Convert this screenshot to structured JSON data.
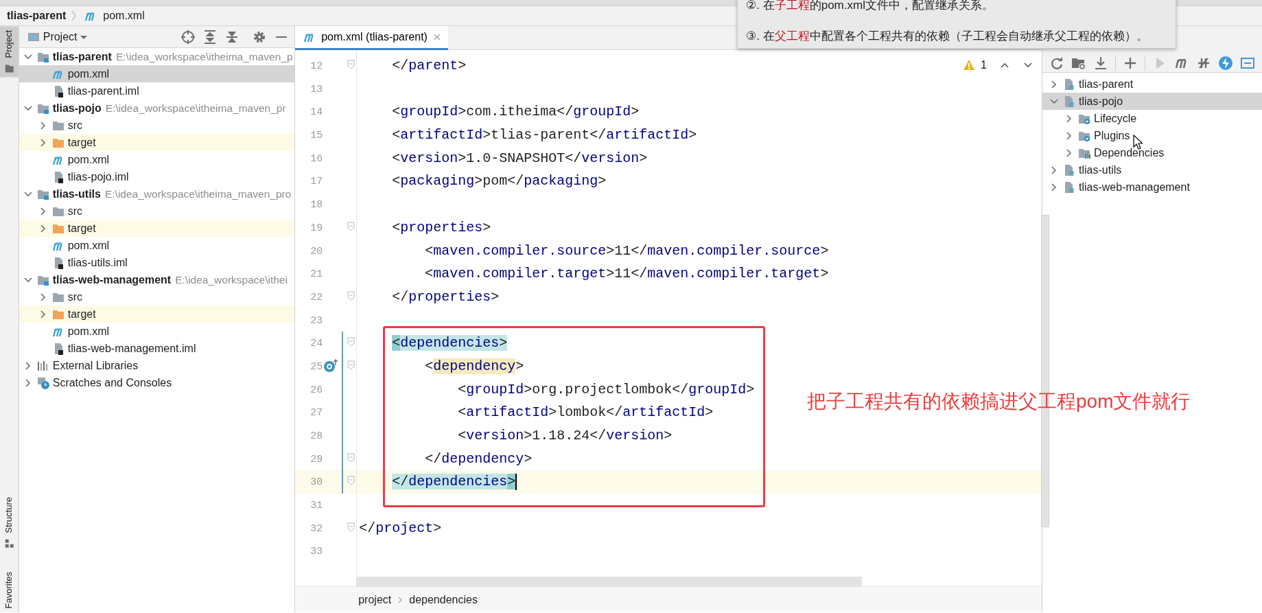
{
  "breadcrumb": {
    "project": "tlias-parent",
    "file": "pom.xml"
  },
  "tool_strip": {
    "top": [
      {
        "label": "Project",
        "kind": "project",
        "selected": true
      }
    ],
    "bottom": [
      {
        "label": "Structure",
        "kind": "structure",
        "selected": false
      },
      {
        "label": "Favorites",
        "kind": "favorites",
        "selected": false
      }
    ]
  },
  "project_panel": {
    "title": "Project",
    "tree": [
      {
        "label": "tlias-parent",
        "path": "E:\\idea_workspace\\itheima_maven_p",
        "kind": "module",
        "expanded": true,
        "selected": false,
        "children": [
          {
            "label": "pom.xml",
            "kind": "maven-file",
            "selected": true
          },
          {
            "label": "tlias-parent.iml",
            "kind": "iml-file",
            "selected": false
          }
        ]
      },
      {
        "label": "tlias-pojo",
        "path": "E:\\idea_workspace\\itheima_maven_pr",
        "kind": "module",
        "expanded": true,
        "selected": false,
        "children": [
          {
            "label": "src",
            "kind": "folder",
            "expanded": false,
            "selected": false
          },
          {
            "label": "target",
            "kind": "excluded-folder",
            "expanded": false,
            "selected": false
          },
          {
            "label": "pom.xml",
            "kind": "maven-file",
            "selected": false
          },
          {
            "label": "tlias-pojo.iml",
            "kind": "iml-file",
            "selected": false
          }
        ]
      },
      {
        "label": "tlias-utils",
        "path": "E:\\idea_workspace\\itheima_maven_pro",
        "kind": "module",
        "expanded": true,
        "selected": false,
        "children": [
          {
            "label": "src",
            "kind": "folder",
            "expanded": false,
            "selected": false
          },
          {
            "label": "target",
            "kind": "excluded-folder",
            "expanded": false,
            "selected": false
          },
          {
            "label": "pom.xml",
            "kind": "maven-file",
            "selected": false
          },
          {
            "label": "tlias-utils.iml",
            "kind": "iml-file",
            "selected": false
          }
        ]
      },
      {
        "label": "tlias-web-management",
        "path": "E:\\idea_workspace\\ithei",
        "kind": "module",
        "expanded": true,
        "selected": false,
        "children": [
          {
            "label": "src",
            "kind": "folder",
            "expanded": false,
            "selected": false
          },
          {
            "label": "target",
            "kind": "excluded-folder",
            "expanded": false,
            "selected": false
          },
          {
            "label": "pom.xml",
            "kind": "maven-file",
            "selected": false
          },
          {
            "label": "tlias-web-management.iml",
            "kind": "iml-file",
            "selected": false
          }
        ]
      },
      {
        "label": "External Libraries",
        "kind": "libraries",
        "expanded": false,
        "selected": false
      },
      {
        "label": "Scratches and Consoles",
        "kind": "scratches",
        "expanded": false,
        "selected": false
      }
    ]
  },
  "editor": {
    "tabs": [
      {
        "label": "pom.xml (tlias-parent)",
        "selected": true
      }
    ],
    "warnings": "1",
    "lines": [
      {
        "number": "12",
        "text": "    </parent>",
        "fold": true,
        "changed": false,
        "current": false
      },
      {
        "number": "13",
        "fold": false,
        "changed": false,
        "current": false
      },
      {
        "number": "14",
        "text": "    <groupId>com.itheima</groupId>",
        "fold": false,
        "changed": false,
        "current": false
      },
      {
        "number": "15",
        "text": "    <artifactId>tlias-parent</artifactId>",
        "fold": false,
        "changed": false,
        "current": false
      },
      {
        "number": "16",
        "text": "    <version>1.0-SNAPSHOT</version>",
        "fold": false,
        "changed": false,
        "current": false
      },
      {
        "number": "17",
        "text": "    <packaging>pom</packaging>",
        "fold": false,
        "changed": false,
        "current": false
      },
      {
        "number": "18",
        "fold": false,
        "changed": false,
        "current": false
      },
      {
        "number": "19",
        "text": "    <properties>",
        "fold": true,
        "changed": false,
        "current": false
      },
      {
        "number": "20",
        "text": "        <maven.compiler.source>11</maven.compiler.source>",
        "fold": false,
        "changed": false,
        "current": false
      },
      {
        "number": "21",
        "text": "        <maven.compiler.target>11</maven.compiler.target>",
        "fold": false,
        "changed": false,
        "current": false
      },
      {
        "number": "22",
        "text": "    </properties>",
        "fold": true,
        "changed": false,
        "current": false
      },
      {
        "number": "23",
        "fold": false,
        "changed": false,
        "current": false
      },
      {
        "number": "24",
        "text": "    <dependencies>",
        "fold": true,
        "changed": true,
        "current": false,
        "tag_match": true,
        "match_start": true
      },
      {
        "number": "25",
        "text": "        <dependency>",
        "fold": true,
        "changed": true,
        "current": false,
        "name_highlight": true,
        "override_icon": true
      },
      {
        "number": "26",
        "text": "            <groupId>org.projectlombok</groupId>",
        "fold": false,
        "changed": true,
        "current": false
      },
      {
        "number": "27",
        "text": "            <artifactId>lombok</artifactId>",
        "fold": false,
        "changed": true,
        "current": false
      },
      {
        "number": "28",
        "text": "            <version>1.18.24</version>",
        "fold": false,
        "changed": true,
        "current": false
      },
      {
        "number": "29",
        "text": "        </dependency>",
        "fold": true,
        "changed": true,
        "current": false
      },
      {
        "number": "30",
        "text": "    </dependencies>",
        "fold": true,
        "changed": true,
        "current": true,
        "tag_match": true,
        "match_end": true
      },
      {
        "number": "31",
        "fold": false,
        "changed": false,
        "current": false
      },
      {
        "number": "32",
        "text": "</project>",
        "fold": true,
        "changed": false,
        "current": false
      },
      {
        "number": "33",
        "fold": false,
        "changed": false,
        "current": false
      }
    ],
    "breadcrumb": [
      "project",
      "dependencies"
    ]
  },
  "annotation": "把子工程共有的依赖搞进父工程pom文件就行",
  "note": {
    "lines": [
      [
        {
          "text": "②. 在",
          "kind": "plain"
        },
        {
          "text": "子工程",
          "kind": "emphasis"
        },
        {
          "text": "的pom.xml文件中，配置继承关系。",
          "kind": "plain"
        }
      ],
      [
        {
          "text": "③. 在",
          "kind": "plain"
        },
        {
          "text": "父工程",
          "kind": "emphasis"
        },
        {
          "text": "中配置各个工程共有的依赖（子工程会自动继承父工程的依赖）。",
          "kind": "plain"
        }
      ]
    ]
  },
  "maven_panel": {
    "tree": [
      {
        "label": "tlias-parent",
        "kind": "maven-project",
        "expanded": false,
        "selected": false
      },
      {
        "label": "tlias-pojo",
        "kind": "maven-project",
        "expanded": true,
        "selected": true,
        "children": [
          {
            "label": "Lifecycle",
            "kind": "config-folder",
            "expanded": false,
            "selected": false
          },
          {
            "label": "Plugins",
            "kind": "config-folder",
            "expanded": false,
            "selected": false
          },
          {
            "label": "Dependencies",
            "kind": "dependencies",
            "expanded": false,
            "selected": false
          }
        ]
      },
      {
        "label": "tlias-utils",
        "kind": "maven-project",
        "expanded": false,
        "selected": false
      },
      {
        "label": "tlias-web-management",
        "kind": "maven-project",
        "expanded": false,
        "selected": false
      }
    ]
  }
}
